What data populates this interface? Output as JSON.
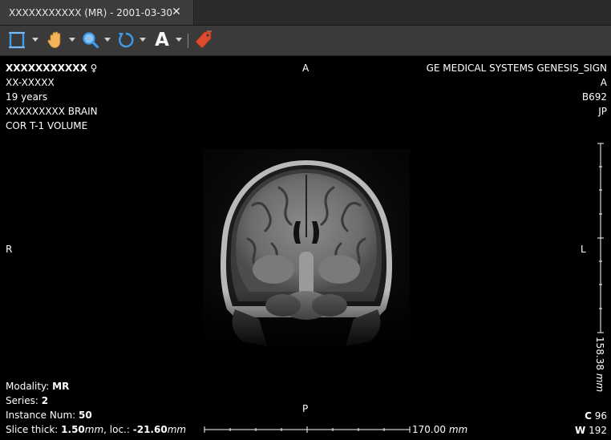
{
  "tab": {
    "title": "XXXXXXXXXXX (MR) - 2001-03-30",
    "close_glyph": "✕"
  },
  "toolbar": {
    "tools": [
      "crop-frame-icon",
      "pan-hand-icon",
      "zoom-magnifier-icon",
      "rotate-icon",
      "text-annotation-icon",
      "tag-icon"
    ],
    "text_tool_glyph": "A"
  },
  "overlay": {
    "top_left": {
      "patient_name": "XXXXXXXXXXX",
      "sex_symbol": "♀",
      "patient_id": "XX-XXXXX",
      "age": "19 years",
      "study": "XXXXXXXXX BRAIN",
      "series_desc": "COR T-1 VOLUME"
    },
    "top_right": {
      "manufacturer": "GE MEDICAL SYSTEMS GENESIS_SIGN",
      "line2": "A",
      "line3": "B692",
      "line4": "JP"
    },
    "orientation": {
      "top": "A",
      "bottom": "P",
      "left": "R",
      "right": "L"
    },
    "bottom_left": {
      "modality_label": "Modality:",
      "modality": "MR",
      "series_label": "Series:",
      "series": "2",
      "instance_label": "Instance Num:",
      "instance": "50",
      "slice_label": "Slice thick:",
      "slice_thick": "1.50",
      "slice_unit": "mm",
      "loc_label": ", loc.:",
      "loc": "-21.60",
      "loc_unit": "mm"
    },
    "bottom_right": {
      "center_label": "C",
      "center": "96",
      "width_label": "W",
      "width": "192"
    },
    "h_ruler": {
      "value": "170.00",
      "unit": "mm"
    },
    "v_ruler": {
      "value": "158.38",
      "unit": "mm"
    }
  },
  "colors": {
    "tab_bg": "#3c3c3c",
    "toolbar_bg": "#3a3a3a",
    "accent_blue": "#3d9be9",
    "hand_orange": "#f3b35a",
    "tag_red": "#e04a2f"
  }
}
